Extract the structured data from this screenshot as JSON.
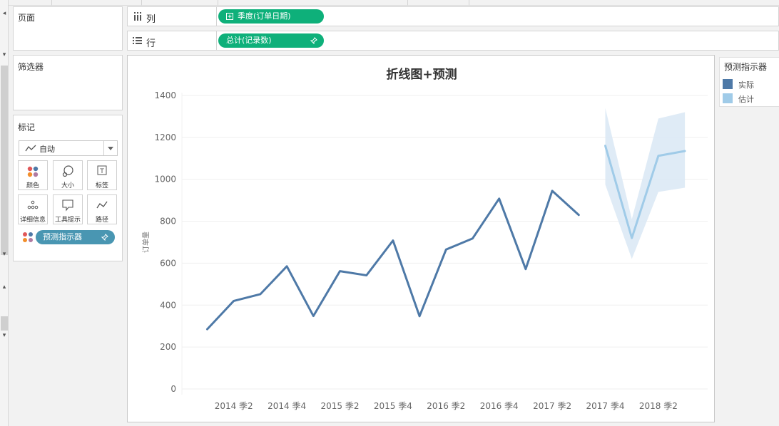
{
  "left_panel": {
    "pages_title": "页面",
    "filters_title": "筛选器",
    "marks": {
      "title": "标记",
      "mark_type": "自动",
      "buttons": [
        {
          "label": "颜色",
          "icon": "color-dots-icon"
        },
        {
          "label": "大小",
          "icon": "size-icon"
        },
        {
          "label": "标签",
          "icon": "label-text-icon"
        },
        {
          "label": "详细信息",
          "icon": "detail-dots-icon"
        },
        {
          "label": "工具提示",
          "icon": "tooltip-icon"
        },
        {
          "label": "路径",
          "icon": "path-icon"
        }
      ],
      "color_pill": "预测指示器"
    }
  },
  "shelves": {
    "columns": {
      "label": "列",
      "pill": "季度(订单日期)"
    },
    "rows": {
      "label": "行",
      "pill": "总计(记录数)"
    }
  },
  "colors": {
    "actual": "#4e79a7",
    "estimate": "#a0cbe8",
    "band": "#d9e8f5",
    "pill_green": "#0eb07a",
    "pill_teal": "#4996b2"
  },
  "legend": {
    "title": "预测指示器",
    "items": [
      {
        "label": "实际",
        "color": "#4e79a7"
      },
      {
        "label": "估计",
        "color": "#a0cbe8"
      }
    ]
  },
  "chart_data": {
    "type": "line",
    "title": "折线图+预测",
    "ylabel": "订单量",
    "xlabel": "",
    "ylim": [
      0,
      1400
    ],
    "yticks": [
      0,
      200,
      400,
      600,
      800,
      1000,
      1200,
      1400
    ],
    "x_tick_labels": [
      "2014 季2",
      "2014 季4",
      "2015 季2",
      "2015 季4",
      "2016 季2",
      "2016 季4",
      "2017 季2",
      "2017 季4",
      "2018 季2"
    ],
    "categories": [
      "2014 季1",
      "2014 季2",
      "2014 季3",
      "2014 季4",
      "2015 季1",
      "2015 季2",
      "2015 季3",
      "2015 季4",
      "2016 季1",
      "2016 季2",
      "2016 季3",
      "2016 季4",
      "2017 季1",
      "2017 季2",
      "2017 季3",
      "2017 季4",
      "2018 季1",
      "2018 季2",
      "2018 季3"
    ],
    "series": [
      {
        "name": "实际",
        "values": [
          285,
          420,
          452,
          585,
          348,
          562,
          542,
          708,
          347,
          665,
          718,
          908,
          572,
          945,
          830,
          null,
          null,
          null,
          null
        ]
      },
      {
        "name": "估计",
        "values": [
          null,
          null,
          null,
          null,
          null,
          null,
          null,
          null,
          null,
          null,
          null,
          null,
          null,
          null,
          null,
          1160,
          720,
          1112,
          1135
        ]
      }
    ],
    "estimate_band": {
      "upper": [
        1340,
        810,
        1290,
        1320
      ],
      "lower": [
        975,
        620,
        940,
        960
      ]
    },
    "grid": true
  }
}
